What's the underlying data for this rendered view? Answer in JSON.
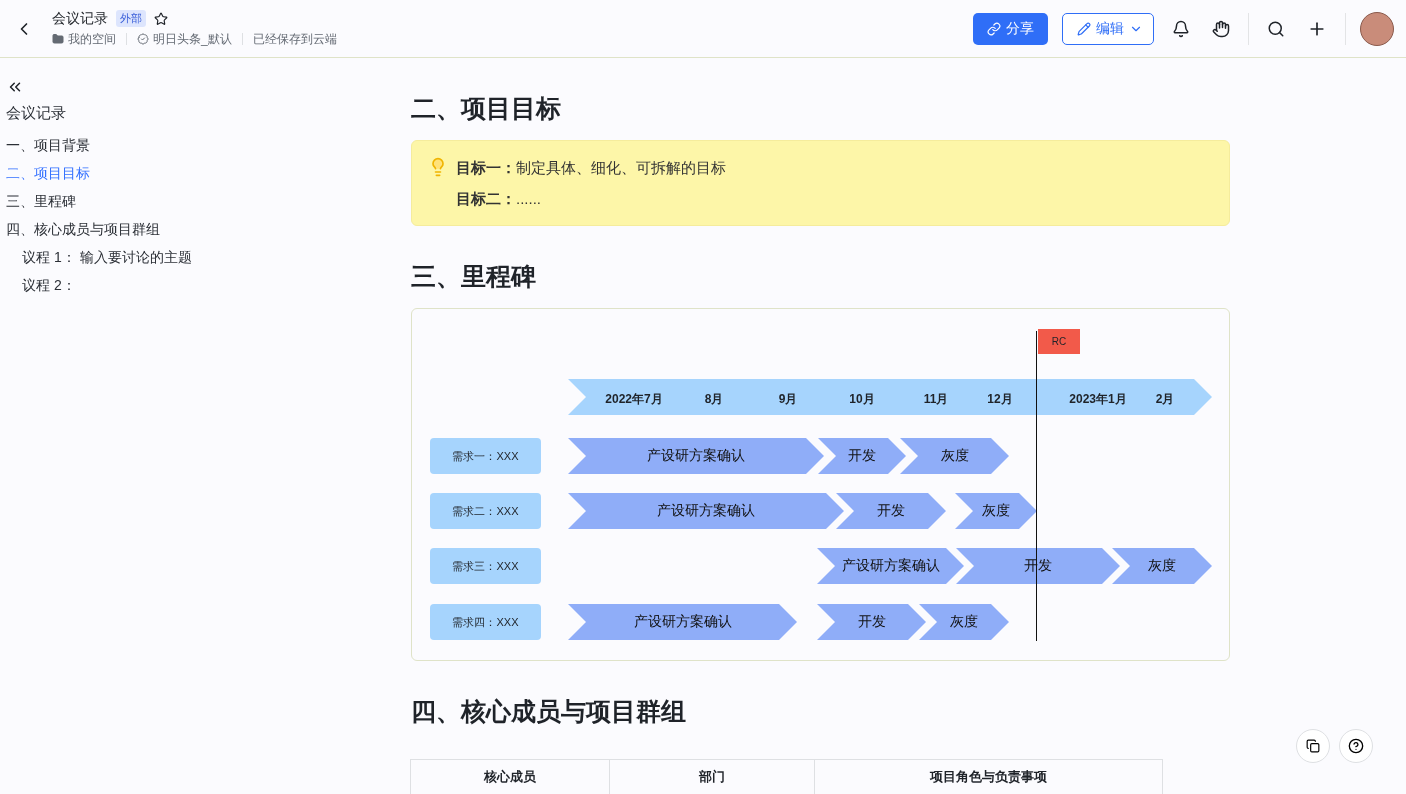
{
  "header": {
    "title": "会议记录",
    "badge": "外部",
    "starred": false,
    "breadcrumbs": [
      {
        "kind": "folder",
        "text": "我的空间"
      },
      {
        "kind": "verified",
        "text": "明日头条_默认"
      },
      {
        "kind": "plain",
        "text": "已经保存到云端"
      }
    ],
    "share_label": "分享",
    "edit_label": "编辑"
  },
  "outline": {
    "title": "会议记录",
    "items": [
      {
        "label": "一、项目背景",
        "selected": false
      },
      {
        "label": "二、项目目标",
        "selected": true
      },
      {
        "label": "三、里程碑",
        "selected": false
      },
      {
        "label": "四、核心成员与项目群组",
        "selected": false,
        "children": [
          {
            "label": "议程 1： 输入要讨论的主题",
            "selected": false
          },
          {
            "label": "议程 2：",
            "selected": false
          }
        ]
      }
    ]
  },
  "sections": [
    {
      "kind": "callout",
      "heading": "二、项目目标",
      "lines": [
        {
          "label": "目标一：",
          "text": "制定具体、细化、可拆解的目标"
        },
        {
          "label": "目标二：",
          "text": "......"
        }
      ]
    },
    {
      "kind": "timeline",
      "heading": "三、里程碑",
      "marker": "RC",
      "months": [
        "2022年7月",
        "8月",
        "9月",
        "10月",
        "11月",
        "12月",
        "2023年1月",
        "2月"
      ],
      "rows": [
        {
          "label": "需求一：XXX",
          "phases": [
            "产设研方案确认",
            "开发",
            "灰度"
          ]
        },
        {
          "label": "需求二：XXX",
          "phases": [
            "产设研方案确认",
            "开发",
            "灰度"
          ]
        },
        {
          "label": "需求三：XXX",
          "phases": [
            "产设研方案确认",
            "开发",
            "灰度"
          ]
        },
        {
          "label": "需求四：XXX",
          "phases": [
            "产设研方案确认",
            "开发",
            "灰度"
          ]
        }
      ]
    },
    {
      "kind": "table",
      "heading": "四、核心成员与项目群组",
      "columns": [
        "核心成员",
        "部门",
        "项目角色与负责事项"
      ]
    }
  ]
}
